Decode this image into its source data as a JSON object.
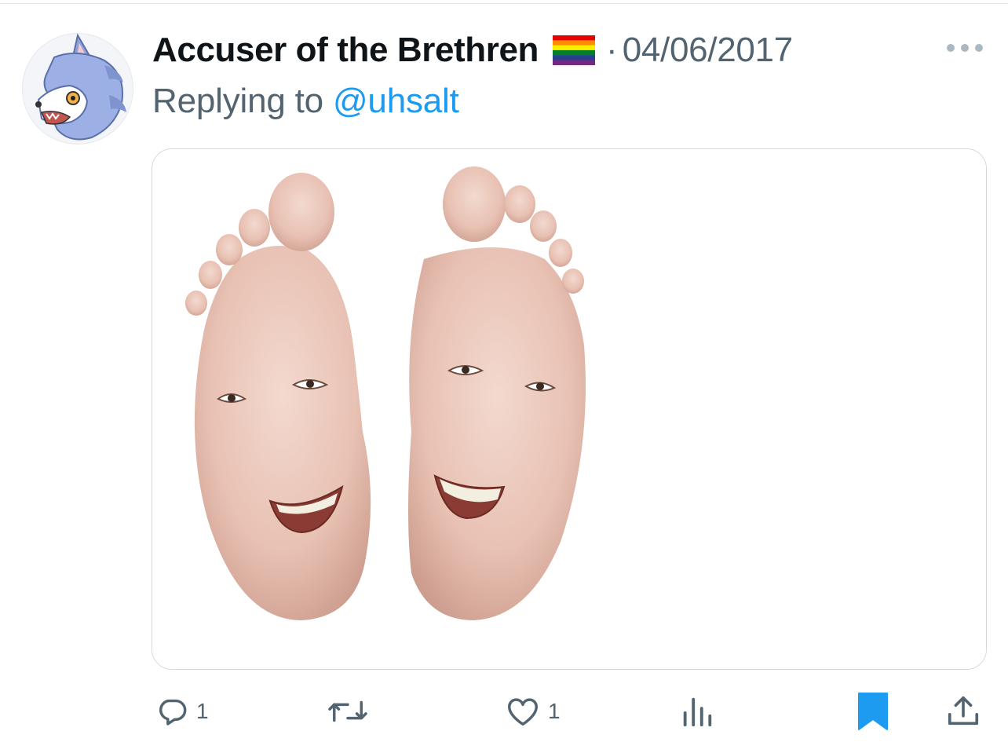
{
  "tweet": {
    "author_name": "Accuser of the Brethren",
    "author_flag_icon": "rainbow-flag-icon",
    "separator": "·",
    "date": "04/06/2017",
    "reply_prefix": "Replying to",
    "reply_handle": "@uhsalt",
    "media": {
      "image_icon": "feet-soles-with-faces-image"
    },
    "actions": {
      "reply": {
        "icon": "reply-icon",
        "count": "1"
      },
      "retweet": {
        "icon": "retweet-icon",
        "count": ""
      },
      "like": {
        "icon": "heart-icon",
        "count": "1"
      },
      "views": {
        "icon": "analytics-icon",
        "count": ""
      },
      "bookmark": {
        "icon": "bookmark-icon",
        "active": true
      },
      "share": {
        "icon": "share-icon"
      }
    }
  },
  "colors": {
    "text_primary": "#0f1419",
    "text_secondary": "#536471",
    "link": "#1d9bf0",
    "bookmark_active": "#1d9bf0",
    "border": "#d3d9de"
  }
}
